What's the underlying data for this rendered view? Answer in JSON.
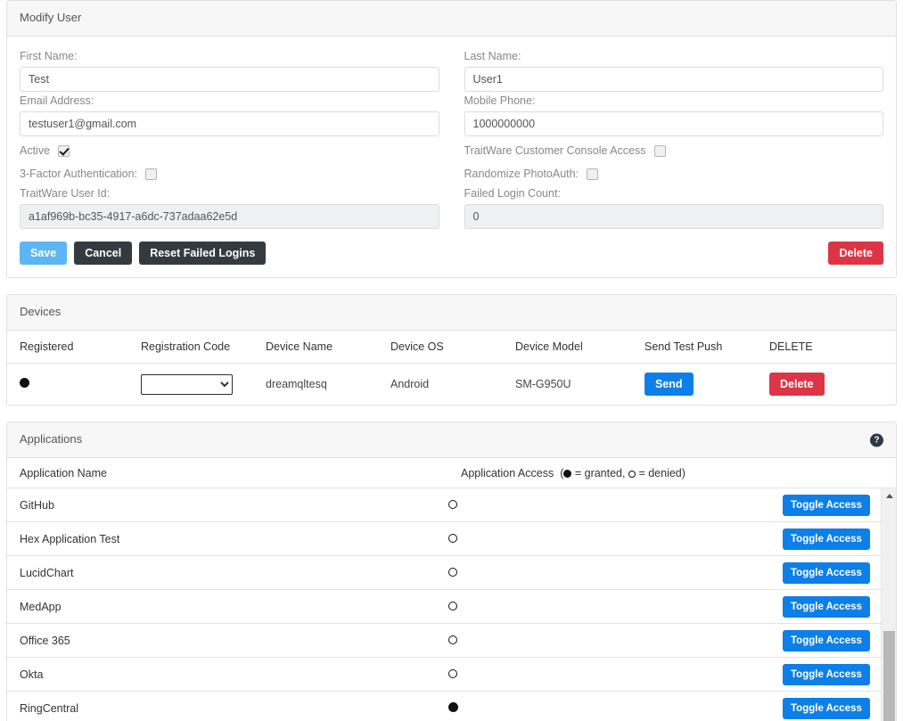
{
  "modify_user": {
    "title": "Modify User",
    "fields": {
      "first_name_label": "First Name:",
      "first_name_value": "Test",
      "last_name_label": "Last Name:",
      "last_name_value": "User1",
      "email_label": "Email Address:",
      "email_value": "testuser1@gmail.com",
      "mobile_label": "Mobile Phone:",
      "mobile_value": "1000000000",
      "active_label": "Active",
      "active_checked": true,
      "console_access_label": "TraitWare Customer Console Access",
      "console_access_checked": false,
      "three_factor_label": "3-Factor Authentication:",
      "three_factor_checked": false,
      "randomize_photoauth_label": "Randomize PhotoAuth:",
      "randomize_photoauth_checked": false,
      "user_id_label": "TraitWare User Id:",
      "user_id_value": "a1af969b-bc35-4917-a6dc-737adaa62e5d",
      "failed_login_label": "Failed Login Count:",
      "failed_login_value": "0"
    },
    "buttons": {
      "save": "Save",
      "cancel": "Cancel",
      "reset_failed_logins": "Reset Failed Logins",
      "delete": "Delete"
    },
    "colors": {
      "save": "#5cb6f2",
      "dark": "#343a40",
      "delete": "#dc3545"
    }
  },
  "devices": {
    "title": "Devices",
    "columns": [
      "Registered",
      "Registration Code",
      "Device Name",
      "Device OS",
      "Device Model",
      "Send Test Push",
      "DELETE"
    ],
    "rows": [
      {
        "registered": "granted",
        "registration_code": "",
        "device_name": "dreamqltesq",
        "device_os": "Android",
        "device_model": "SM-G950U",
        "send_label": "Send",
        "delete_label": "Delete"
      }
    ],
    "colors": {
      "send": "#0d7fe8",
      "delete": "#dc3545"
    }
  },
  "applications": {
    "title": "Applications",
    "help_icon_glyph": "?",
    "column_name_header": "Application Name",
    "column_access_header_prefix": "Application Access",
    "legend_granted": "= granted,",
    "legend_denied": "= denied)",
    "toggle_label": "Toggle Access",
    "accent": "#0d7fe8",
    "rows": [
      {
        "name": "GitHub",
        "access": "denied"
      },
      {
        "name": "Hex Application Test",
        "access": "denied"
      },
      {
        "name": "LucidChart",
        "access": "denied"
      },
      {
        "name": "MedApp",
        "access": "denied"
      },
      {
        "name": "Office 365",
        "access": "denied"
      },
      {
        "name": "Okta",
        "access": "denied"
      },
      {
        "name": "RingCentral",
        "access": "granted"
      }
    ]
  }
}
